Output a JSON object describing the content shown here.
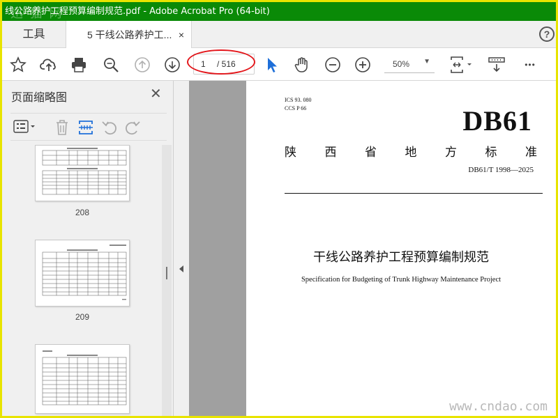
{
  "window": {
    "title": "线公路养护工程预算编制规范.pdf - Adobe Acrobat Pro (64-bit)",
    "overlay_watermark": "迅 猫 网",
    "frame_color": "#e8e400",
    "titlebar_color": "#0a8a07"
  },
  "tabs": {
    "tools_label": "工具",
    "doc_label": "5 干线公路养护工...",
    "close_glyph": "×",
    "help_glyph": "?"
  },
  "toolbar": {
    "icons": [
      "star-icon",
      "cloud-upload-icon",
      "print-icon",
      "zoom-search-icon",
      "page-up-icon",
      "page-down-icon",
      "select-cursor-icon",
      "hand-icon",
      "zoom-out-icon",
      "zoom-in-icon",
      "fit-page-icon",
      "scroll-mode-icon",
      "more-icon"
    ],
    "page_current": "1",
    "page_total": "/ 516",
    "zoom_value": "50%",
    "zoom_arrow": "▼",
    "more_glyph": "•••"
  },
  "sidebar": {
    "title": "页面缩略图",
    "close_glyph": "✕",
    "thumbnails": [
      {
        "label": "208"
      },
      {
        "label": "209"
      },
      {
        "label": ""
      }
    ]
  },
  "document": {
    "ics": "ICS  93. 080",
    "ccs": "CCS P 66",
    "code": "DB61",
    "province_chars": [
      "陕",
      "西",
      "省",
      "地",
      "方",
      "标",
      "准"
    ],
    "standard_number": "DB61/T 1998—2025",
    "title_cn": "干线公路养护工程预算编制规范",
    "title_en": "Specification for Budgeting of Trunk Highway Maintenance Project"
  },
  "watermark_bottom": "www.cndao.com"
}
